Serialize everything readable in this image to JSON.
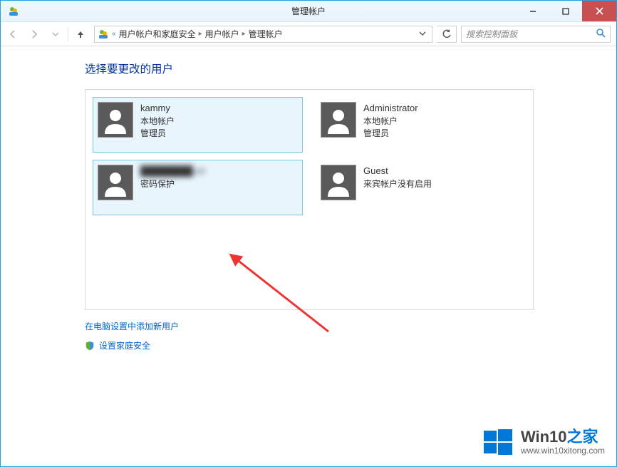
{
  "window": {
    "title": "管理帐户"
  },
  "nav": {
    "breadcrumb": {
      "sep0": "«",
      "item1": "用户帐户和家庭安全",
      "item2": "用户帐户",
      "item3": "管理帐户"
    },
    "search_placeholder": "搜索控制面板"
  },
  "page": {
    "heading": "选择要更改的用户",
    "link_add_user": "在电脑设置中添加新用户",
    "link_family_safety": "设置家庭安全"
  },
  "users": [
    {
      "name": "kammy",
      "line2": "本地帐户",
      "line3": "管理员",
      "selected": true
    },
    {
      "name": "Administrator",
      "line2": "本地帐户",
      "line3": "管理员",
      "selected": false
    },
    {
      "name": "████████.cn",
      "line2": "密码保护",
      "line3": "",
      "selected": true,
      "obscured": true
    },
    {
      "name": "Guest",
      "line2": "来宾帐户没有启用",
      "line3": "",
      "selected": false
    }
  ],
  "watermark": {
    "line1a": "Win10",
    "line1b": "之家",
    "line2": "www.win10xitong.com"
  }
}
